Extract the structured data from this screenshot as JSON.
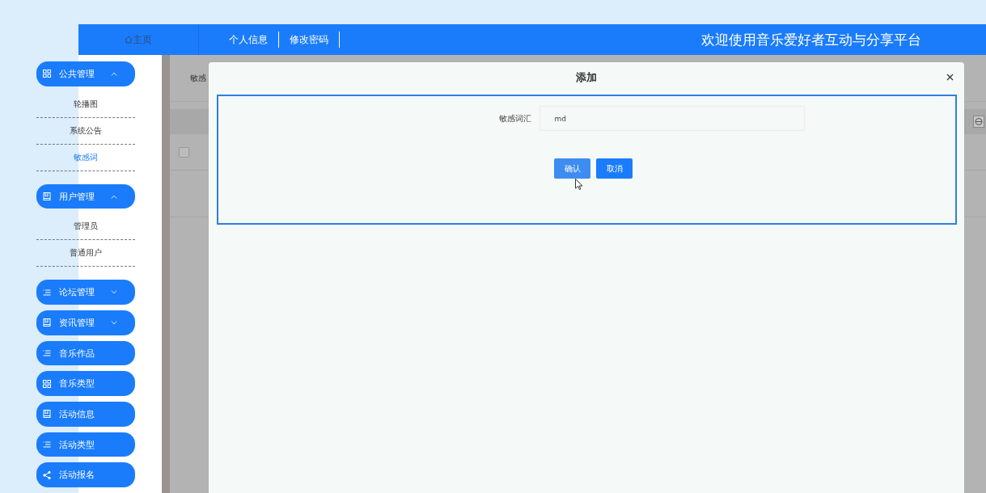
{
  "header": {
    "home": "主页",
    "links": [
      "个人信息",
      "修改密码"
    ],
    "title": "欢迎使用音乐爱好者互动与分享平台"
  },
  "sidebar": {
    "items": [
      {
        "kind": "group",
        "label": "公共管理",
        "expanded": true,
        "children": [
          {
            "label": "轮播图",
            "selected": false
          },
          {
            "label": "系统公告",
            "selected": false
          },
          {
            "label": "敏感词",
            "selected": true
          }
        ]
      },
      {
        "kind": "group",
        "label": "用户管理",
        "expanded": true,
        "children": [
          {
            "label": "管理员",
            "selected": false
          },
          {
            "label": "普通用户",
            "selected": false
          }
        ]
      },
      {
        "kind": "group",
        "label": "论坛管理",
        "expanded": false
      },
      {
        "kind": "group",
        "label": "资讯管理",
        "expanded": false
      },
      {
        "kind": "link",
        "label": "音乐作品"
      },
      {
        "kind": "link",
        "label": "音乐类型"
      },
      {
        "kind": "link",
        "label": "活动信息"
      },
      {
        "kind": "link",
        "label": "活动类型"
      },
      {
        "kind": "link",
        "label": "活动报名"
      }
    ]
  },
  "background": {
    "search_label": "敏感",
    "row_checked": false
  },
  "dialog": {
    "title": "添加",
    "field": {
      "label": "敏感词汇",
      "value": "md"
    },
    "buttons": [
      {
        "label": "确认",
        "hovered": true
      },
      {
        "label": "取消",
        "hovered": false
      }
    ]
  }
}
